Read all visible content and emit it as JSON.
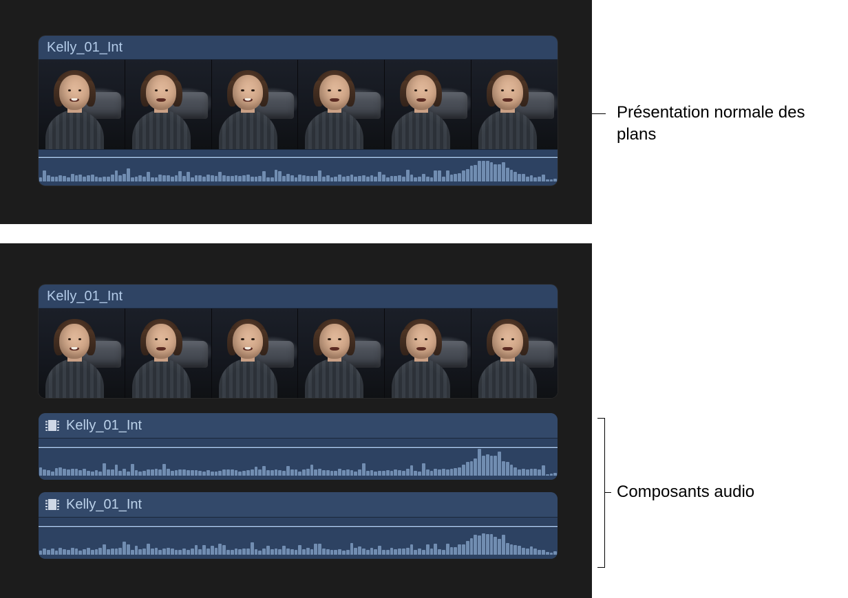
{
  "clips": {
    "normal": {
      "title": "Kelly_01_Int"
    },
    "expanded": {
      "title": "Kelly_01_Int",
      "audio": [
        {
          "label": "Kelly_01_Int"
        },
        {
          "label": "Kelly_01_Int"
        }
      ]
    }
  },
  "annotations": {
    "normal": "Présentation normale des plans",
    "components": "Composants audio"
  }
}
